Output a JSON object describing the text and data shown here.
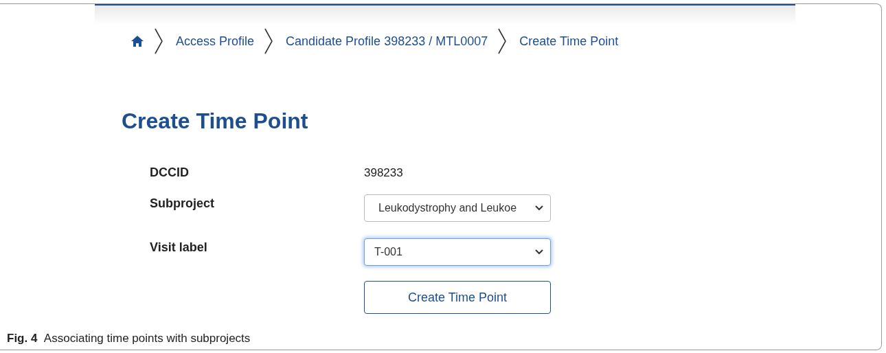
{
  "breadcrumbs": [
    {
      "label": "Access Profile"
    },
    {
      "label": "Candidate Profile 398233 / MTL0007"
    },
    {
      "label": "Create Time Point"
    }
  ],
  "heading": "Create Time Point",
  "fields": [
    {
      "label": "DCCID",
      "kind": "text",
      "value": "398233"
    },
    {
      "label": "Subproject",
      "kind": "select",
      "value": "Leukodystrophy and Leukoe",
      "focused": false
    },
    {
      "label": "Visit label",
      "kind": "select",
      "value": "T-001",
      "focused": true
    }
  ],
  "button": "Create Time Point",
  "caption": {
    "label": "Fig. 4",
    "text": "Associating time points with subprojects"
  }
}
